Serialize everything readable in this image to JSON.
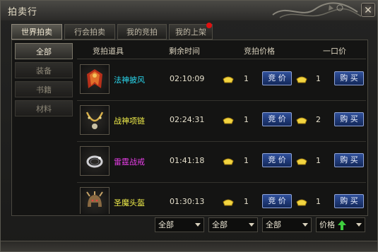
{
  "window": {
    "title": "拍卖行"
  },
  "tabs": [
    {
      "label": "世界拍卖",
      "active": true
    },
    {
      "label": "行会拍卖",
      "active": false
    },
    {
      "label": "我的竞拍",
      "active": false
    },
    {
      "label": "我的上架",
      "active": false,
      "has_notification": true
    }
  ],
  "sidebar": [
    {
      "label": "全部",
      "active": true
    },
    {
      "label": "装备",
      "active": false
    },
    {
      "label": "书籍",
      "active": false
    },
    {
      "label": "材料",
      "active": false
    }
  ],
  "table": {
    "headers": {
      "item": "竞拍道具",
      "time": "剩余时间",
      "bid_price": "竞拍价格",
      "buyout": "一口价"
    },
    "bid_button": "竞 价",
    "buy_button": "购 买",
    "rows": [
      {
        "name": "法神披风",
        "name_color": "#29d9f0",
        "icon": "cloak-icon",
        "time": "02:10:09",
        "bid": "1",
        "buyout": "1"
      },
      {
        "name": "战神项链",
        "name_color": "#f2ef4a",
        "icon": "necklace-icon",
        "time": "02:24:31",
        "bid": "1",
        "buyout": "2"
      },
      {
        "name": "雷霆战戒",
        "name_color": "#e83ee8",
        "icon": "ring-icon",
        "time": "01:41:18",
        "bid": "1",
        "buyout": "1"
      },
      {
        "name": "圣魔头盔",
        "name_color": "#f2ef4a",
        "icon": "helmet-icon",
        "time": "01:30:13",
        "bid": "1",
        "buyout": "1"
      }
    ]
  },
  "filters": [
    {
      "value": "全部"
    },
    {
      "value": "全部"
    },
    {
      "value": "全部"
    },
    {
      "value": "价格",
      "sort_icon": "green-up-arrow-icon"
    }
  ],
  "colors": {
    "gold": "#f2d440",
    "button_blue": "#1f3a7a",
    "notification": "#e01010"
  }
}
